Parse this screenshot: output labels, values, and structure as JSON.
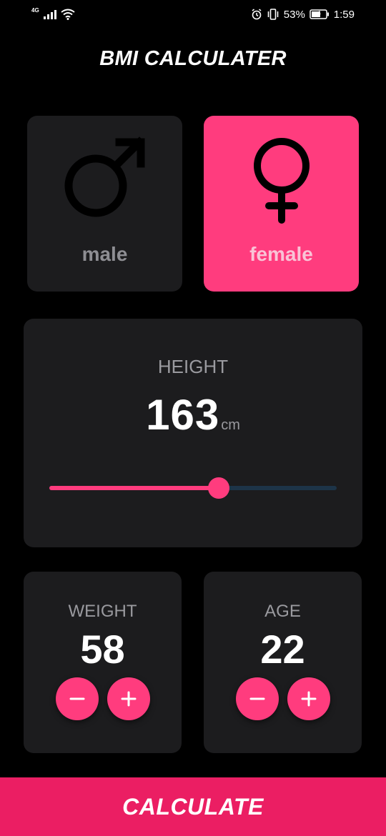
{
  "status_bar": {
    "network": "4G",
    "battery_percent": "53%",
    "time": "1:59"
  },
  "app": {
    "title": "BMI CALCULATER"
  },
  "gender": {
    "male_label": "male",
    "female_label": "female",
    "selected": "female"
  },
  "height": {
    "label": "HEIGHT",
    "value": "163",
    "unit": "cm",
    "slider_fraction": 0.59
  },
  "weight": {
    "label": "WEIGHT",
    "value": "58"
  },
  "age": {
    "label": "AGE",
    "value": "22"
  },
  "actions": {
    "calculate_label": "CALCULATE"
  },
  "icons": {
    "male": "male-symbol-icon",
    "female": "female-symbol-icon",
    "decrement": "minus-icon",
    "increment": "plus-icon"
  },
  "colors": {
    "accent": "#ff3c7e",
    "calculate_bg": "#eb1e63",
    "card_bg": "#1c1c1e",
    "slider_inactive": "#1d3448"
  }
}
